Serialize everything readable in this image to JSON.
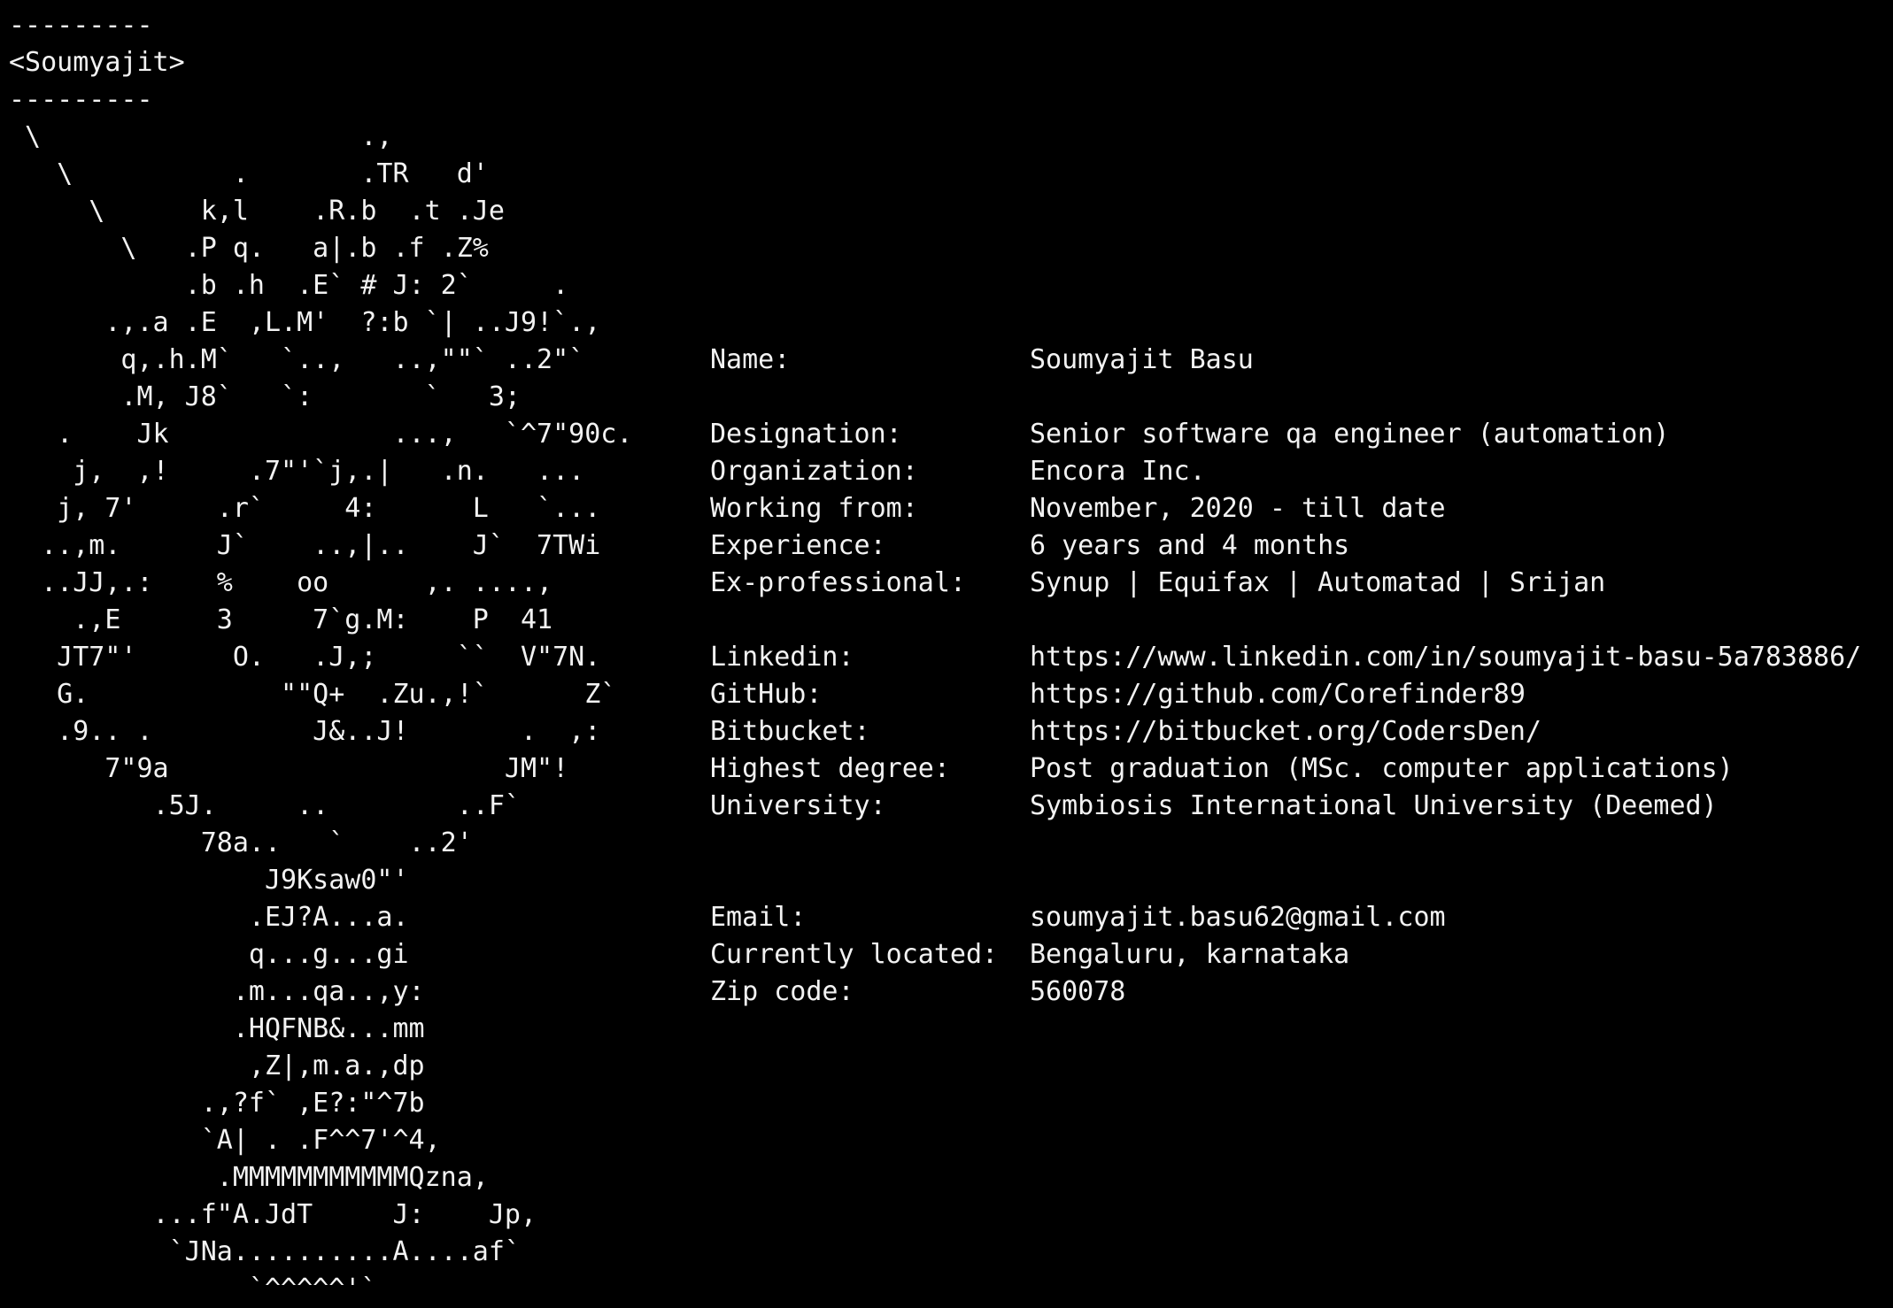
{
  "header": {
    "rule_top": "---------",
    "username": "<Soumyajit>",
    "rule_bottom": "---------"
  },
  "ascii_art": [
    " \\                    .,",
    "   \\          .       .TR   d'",
    "     \\      k,l    .R.b  .t .Je",
    "       \\   .P q.   a|.b .f .Z%",
    "           .b .h  .E` # J: 2`     .",
    "      .,.a .E  ,L.M'  ?:b `| ..J9!`.,",
    "       q,.h.M`   `..,   ..,\"\"` ..2\"`",
    "       .M, J8`   `:       `   3;",
    "   .    Jk              ...,   `^7\"90c.",
    "    j,  ,!     .7\"'`j,.|   .n.   ...",
    "   j, 7'     .r`     4:      L   `...",
    "  ..,m.      J`    ..,|..    J`  7TWi",
    "  ..JJ,.:    %    oo      ,. ....,",
    "    .,E      3     7`g.M:    P  41",
    "   JT7\"'      O.   .J,;     ``  V\"7N.",
    "   G.            \"\"Q+  .Zu.,!`      Z`",
    "   .9.. .          J&..J!       .  ,:",
    "      7\"9a                     JM\"!",
    "         .5J.     ..        ..F`",
    "            78a..   `    ..2'",
    "                J9Ksaw0\"'",
    "               .EJ?A...a.",
    "               q...g...gi",
    "              .m...qa..,y:",
    "              .HQFNB&...mm",
    "               ,Z|,m.a.,dp",
    "            .,?f` ,E?:\"^7b",
    "            `A| . .F^^7'^4,",
    "             .MMMMMMMMMMMQzna,",
    "         ...f\"A.JdT     J:    Jp,",
    "          `JNa..........A....af`",
    "               `^^^^^'`"
  ],
  "info": [
    {
      "label": "Name:",
      "value": "Soumyajit Basu",
      "row": 6
    },
    {
      "label": "Designation:",
      "value": "Senior software qa engineer (automation)",
      "row": 8
    },
    {
      "label": "Organization:",
      "value": "Encora Inc.",
      "row": 9
    },
    {
      "label": "Working from:",
      "value": "November, 2020 - till date",
      "row": 10
    },
    {
      "label": "Experience:",
      "value": "6 years and 4 months",
      "row": 11
    },
    {
      "label": "Ex-professional:",
      "value": "Synup | Equifax | Automatad | Srijan",
      "row": 12
    },
    {
      "label": "Linkedin:",
      "value": "https://www.linkedin.com/in/soumyajit-basu-5a783886/",
      "row": 14
    },
    {
      "label": "GitHub:",
      "value": "https://github.com/Corefinder89",
      "row": 15
    },
    {
      "label": "Bitbucket:",
      "value": "https://bitbucket.org/CodersDen/",
      "row": 16
    },
    {
      "label": "Highest degree:",
      "value": "Post graduation (MSc. computer applications)",
      "row": 17
    },
    {
      "label": "University:",
      "value": "Symbiosis International University (Deemed)",
      "row": 18
    },
    {
      "label": "Email:",
      "value": "soumyajit.basu62@gmail.com",
      "row": 21
    },
    {
      "label": "Currently located:",
      "value": "Bengaluru, karnataka",
      "row": 22
    },
    {
      "label": "Zip code:",
      "value": "560078",
      "row": 23
    }
  ],
  "colors": {
    "background": "#000000",
    "text": "#f2f2f2"
  }
}
